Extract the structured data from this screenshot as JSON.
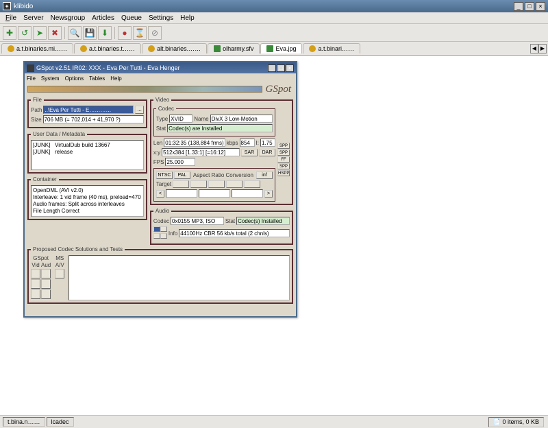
{
  "klibido": {
    "title": "klibido",
    "menu": {
      "file": "File",
      "server": "Server",
      "newsgroup": "Newsgroup",
      "articles": "Articles",
      "queue": "Queue",
      "settings": "Settings",
      "help": "Help"
    },
    "tabs": [
      {
        "label": "a.t.binaries.mi……",
        "active": false
      },
      {
        "label": "a.t.binaries.t……",
        "active": false
      },
      {
        "label": "alt.binaries.……",
        "active": false
      },
      {
        "label": "olharmy.sfv",
        "active": false
      },
      {
        "label": "Eva.jpg",
        "active": true
      },
      {
        "label": "a.t.binari……",
        "active": false
      }
    ],
    "status": {
      "left1": "t.bina.n……",
      "left2": "lcadec",
      "right": "0 items, 0 KB"
    }
  },
  "gspot": {
    "title": "GSpot v2.51 IR02: XXX - Eva Per Tutti - Eva Henger",
    "menu": {
      "file": "File",
      "system": "System",
      "options": "Options",
      "tables": "Tables",
      "help": "Help"
    },
    "brand": "GSpot",
    "file": {
      "legend": "File",
      "path_label": "Path",
      "path_value": "..\\Eva Per Tutti - E…………",
      "browse_btn": "...",
      "size_label": "Size",
      "size_value": "706 MB (= 702,014 + 41,970 ?)"
    },
    "userdata": {
      "legend": "User Data / Metadata",
      "text": "[JUNK]   VirtualDub build 13667\n[JUNK]   release"
    },
    "container": {
      "legend": "Container",
      "text": "OpenDML (AVI v2.0)\nInterleave: 1 vid frame (40 ms), preload=470\nAudio frames: Split across interleaves\nFile Length Correct"
    },
    "proposed": {
      "legend": "Proposed Codec Solutions and Tests",
      "gspot_label": "GSpot",
      "ms_label": "MS",
      "vid_label": "Vid",
      "aud_label": "Aud",
      "av_label": "A/V"
    },
    "video": {
      "legend": "Video",
      "codec": {
        "legend": "Codec",
        "type_label": "Type",
        "type_value": "XVID",
        "name_label": "Name",
        "name_value": "DivX 3 Low-Motion",
        "stat_label": "Stat",
        "stat_value": "Codec(s) are Installed"
      },
      "len_label": "Len",
      "len_value": "01:32:35 (138,884 frms)",
      "kbps_label": "kbps",
      "kbps_value": "854",
      "L_label": "I:",
      "L_value": "1.75",
      "xy_label": "x:y",
      "xy_value": "512x384 [1.33:1] [=16:12]",
      "sar_btn": "SAR",
      "dar_btn": "DAR",
      "fps_label": "FPS",
      "fps_value": "25.000",
      "ratio_btns": {
        "ntsc": "NTSC",
        "pal": "PAL",
        "label": "Aspect Ratio Conversion",
        "inf": "inf"
      },
      "target_label": "Target",
      "arrow_left": "<",
      "arrow_right": ">",
      "side": [
        "SPP",
        "SPP",
        "FF",
        "SPP",
        "HSPP"
      ]
    },
    "audio": {
      "legend": "Audio",
      "codec_label": "Codec",
      "codec_value": "0x0155 MP3, ISO",
      "stat_label": "Stat",
      "stat_value": "Codec(s) Installed",
      "info_label": "Info",
      "info_value": "44100Hz  CBR  56 kb/s total (2 chnls)"
    }
  }
}
